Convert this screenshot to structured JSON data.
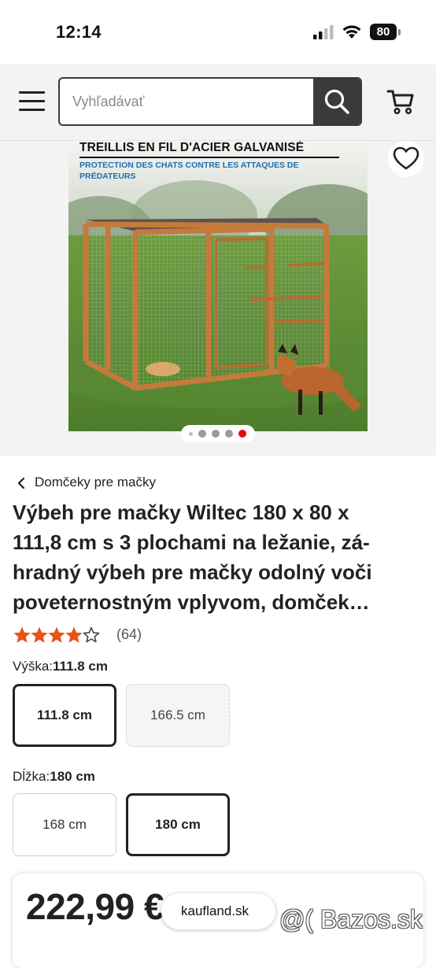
{
  "status_bar": {
    "time": "12:14",
    "battery": "80"
  },
  "header": {
    "search_placeholder": "Vyhľadávať",
    "menu_icon": "hamburger-menu-icon",
    "search_icon": "search-icon",
    "cart_icon": "shopping-cart-icon"
  },
  "gallery": {
    "image_headline": "TREILLIS EN FIL D'ACIER GALVANISÉ",
    "image_subline": "PROTECTION DES CHATS CONTRE LES ATTAQUES DE PRÉDATEURS",
    "dots_total": 5,
    "active_dot": 5,
    "favorite_icon": "heart-icon"
  },
  "breadcrumb": {
    "label": "Domčeky pre mačky"
  },
  "product": {
    "title_lines": [
      "Výbeh pre mačky Wiltec 180 x 80 x",
      "111,8 cm s 3 plochami na ležanie, zá-",
      "hradný výbeh pre mačky odolný voči",
      "poveternostným vplyvom, domček…"
    ],
    "rating": 4,
    "rating_max": 5,
    "review_count": "(64)"
  },
  "options": {
    "height": {
      "label": "Výška:",
      "selected": "111.8 cm",
      "values": [
        "111.8 cm",
        "166.5 cm"
      ]
    },
    "length": {
      "label": "Dĺžka:",
      "selected": "180 cm",
      "values": [
        "168 cm",
        "180 cm"
      ]
    }
  },
  "price": {
    "value": "222,99 €"
  },
  "browser": {
    "url": "kaufland.sk"
  },
  "watermark": "@( Bazos.sk",
  "colors": {
    "accent_star": "#e5541b",
    "active_dot": "#e10915",
    "dark_button": "#3a3a3a"
  }
}
